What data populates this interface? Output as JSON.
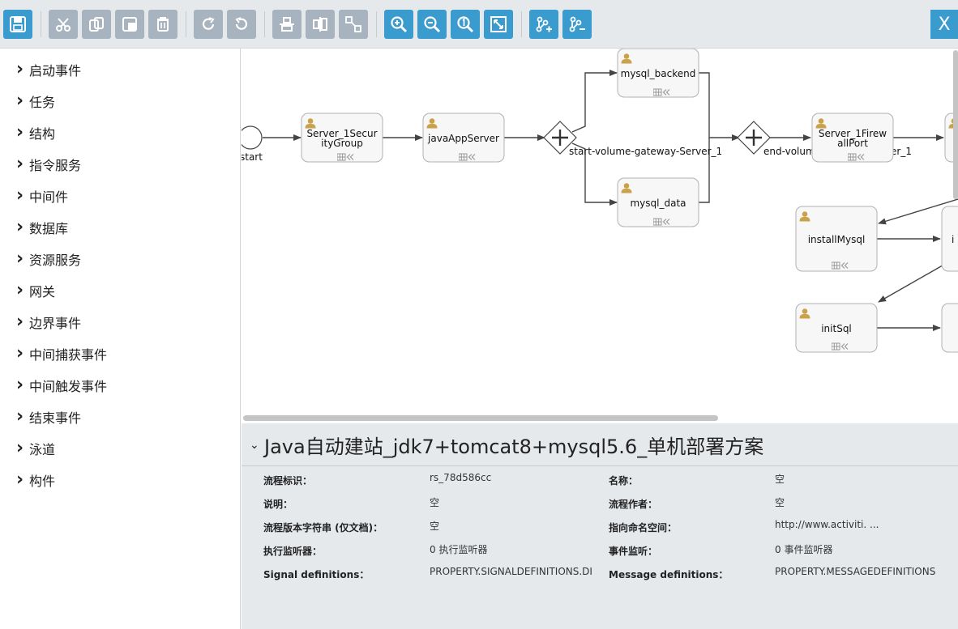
{
  "toolbar": {
    "buttons": [
      "save-icon",
      "cut-icon",
      "copy-icon",
      "paste-icon",
      "delete-icon",
      "redo-icon",
      "undo-icon",
      "align-vertical-icon",
      "align-horizontal-icon",
      "same-size-icon",
      "zoom-in-icon",
      "zoom-out-icon",
      "zoom-actual-icon",
      "zoom-fit-icon",
      "bend-point-add-icon",
      "bend-point-remove-icon"
    ],
    "close_label": "X"
  },
  "palette": {
    "items": [
      "启动事件",
      "任务",
      "结构",
      "指令服务",
      "中间件",
      "数据库",
      "资源服务",
      "网关",
      "边界事件",
      "中间捕获事件",
      "中间触发事件",
      "结束事件",
      "泳道",
      "构件"
    ]
  },
  "canvas": {
    "start_label": "start",
    "tasks": {
      "security_group": [
        "Server_1Secur",
        "ityGroup"
      ],
      "java_app_server": "javaAppServer",
      "mysql_backend": "mysql_backend",
      "mysql_data": "mysql_data",
      "firewall_port": [
        "Server_1Firew",
        "allPort"
      ],
      "install_mysql": "installMysql",
      "init_sql": "initSql"
    },
    "gateway_start_label": "start-volume-gateway-Server_1",
    "gateway_end_label_a": "end-volum",
    "gateway_end_label_b": "er_1",
    "partial_label": "i"
  },
  "properties": {
    "title": "Java自动建站_jdk7+tomcat8+mysql5.6_单机部署方案",
    "left": [
      {
        "label": "流程标识：",
        "value": "rs_78d586cc"
      },
      {
        "label": "说明：",
        "value": "空"
      },
      {
        "label": "流程版本字符串 (仅文档)：",
        "value": "空"
      },
      {
        "label": "执行监听器：",
        "value": "0 执行监听器"
      },
      {
        "label": "Signal definitions：",
        "value": "PROPERTY.SIGNALDEFINITIONS.DI"
      }
    ],
    "right": [
      {
        "label": "名称：",
        "value": "空"
      },
      {
        "label": "流程作者：",
        "value": "空"
      },
      {
        "label": "指向命名空间：",
        "value": "http://www.activiti. ..."
      },
      {
        "label": "事件监听：",
        "value": "0 事件监听器"
      },
      {
        "label": "Message definitions：",
        "value": "PROPERTY.MESSAGEDEFINITIONS"
      }
    ]
  },
  "colors": {
    "accent": "#3a9bcf",
    "disabled": "#a7b4bf",
    "toolbar_bg": "#e6e9ec",
    "user_icon": "#c9a24a"
  }
}
